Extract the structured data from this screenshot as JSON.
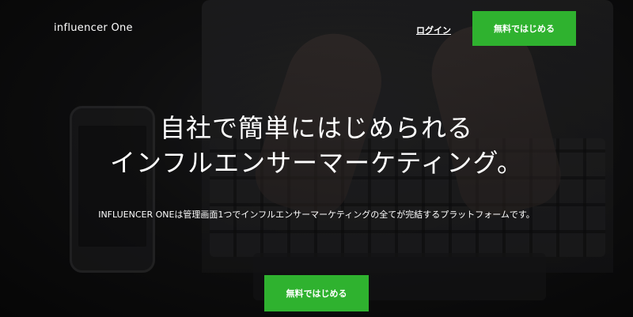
{
  "header": {
    "logo": "influencer One",
    "login_label": "ログイン",
    "cta_label": "無料ではじめる"
  },
  "hero": {
    "headline_line1": "自社で簡単にはじめられる",
    "headline_line2": "インフルエンサーマーケティング。",
    "subtext": "INFLUENCER ONEは管理画面1つでインフルエンサーマーケティングの全てが完結するプラットフォームです。",
    "cta_label": "無料ではじめる"
  },
  "colors": {
    "accent": "#2fb22f",
    "text": "#ffffff",
    "background": "#0c0c0d"
  }
}
